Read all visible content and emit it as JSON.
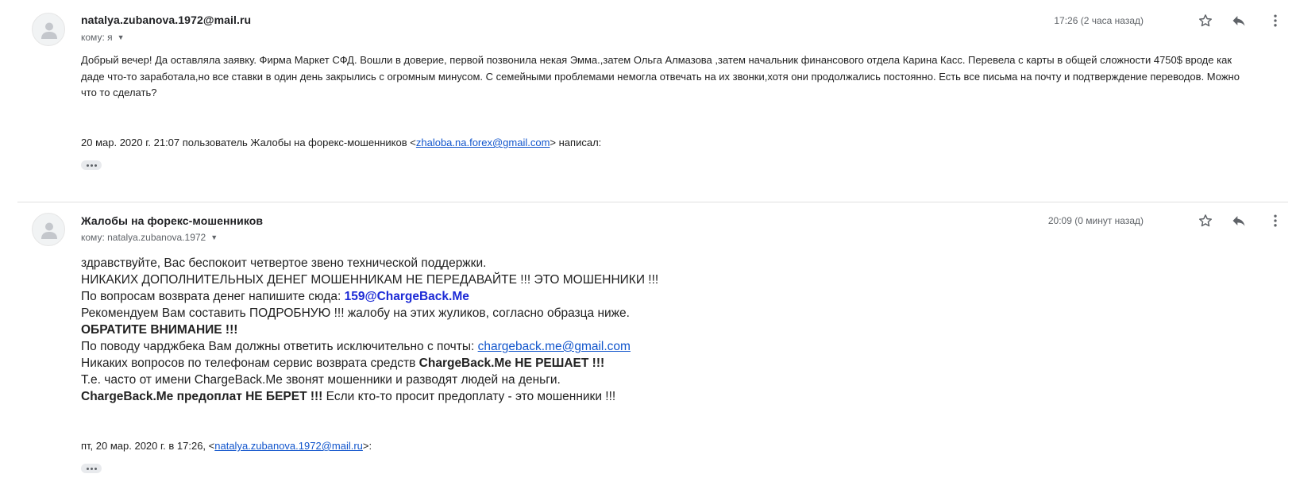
{
  "messages": [
    {
      "sender": "natalya.zubanova.1972@mail.ru",
      "to_label": "кому: я",
      "time": "17:26 (2 часа назад)",
      "body": "Добрый вечер! Да оставляла заявку. Фирма Маркет СФД.  Вошли в доверие, первой позвонила некая Эмма.,затем Ольга Алмазова ,затем начальник финансового отдела  Карина Касс. Перевела с карты в общей сложности 4750$ вроде как даде что-то заработала,но все ставки в один день закрылись с огромным минусом. С семейными проблемами немогла отвечать на их звонки,хотя они продолжались постоянно. Есть все письма на почту и подтверждение переводов. Можно что то сделать?",
      "quote_prefix": "20 мар. 2020 г. 21:07 пользователь Жалобы на форекс-мошенников <",
      "quote_email": "zhaloba.na.forex@gmail.com",
      "quote_suffix": "> написал:"
    },
    {
      "sender": "Жалобы на форекс-мошенников",
      "to_label": "кому: natalya.zubanova.1972",
      "time": "20:09 (0 минут назад)",
      "lines": {
        "l1": "здравствуйте, Вас беспокоит четвертое звено технической поддержки.",
        "l2": "НИКАКИХ ДОПОЛНИТЕЛЬНЫХ ДЕНЕГ МОШЕННИКАМ НЕ ПЕРЕДАВАЙТЕ !!! ЭТО МОШЕННИКИ !!!",
        "l3_text": "По вопросам возврата денег напишите сюда: ",
        "l3_email": "159@ChargeBack.Me",
        "l4": "Рекомендуем Вам составить ПОДРОБНУЮ !!! жалобу на этих жуликов, согласно образца ниже.",
        "l5": "ОБРАТИТЕ ВНИМАНИЕ !!!",
        "l6_text": "По поводу чарджбека Вам должны ответить исключительно с почты: ",
        "l6_link": "chargeback.me@gmail.com",
        "l7_text": "Никаких вопросов по телефонам сервис возврата средств ",
        "l7_bold": "ChargeBack.Me НЕ РЕШАЕТ !!!",
        "l8": "Т.е. часто от имени ChargeBack.Me звонят мошенники и разводят людей на деньги.",
        "l9_bold": "ChargeBack.Me предоплат НЕ БЕРЕТ !!!",
        "l9_text": " Если кто-то просит предоплату - это мошенники !!!"
      },
      "quote_prefix": "пт, 20 мар. 2020 г. в 17:26, <",
      "quote_email": "natalya.zubanova.1972@mail.ru",
      "quote_suffix": ">:"
    }
  ],
  "icons": {
    "avatar": "person-icon",
    "star": "star-icon",
    "reply": "reply-icon",
    "more": "more-vert-icon",
    "expand": "ellipsis-icon"
  },
  "colors": {
    "link": "#1155cc",
    "highlight_email": "#1c2ad6",
    "secondary_text": "#5f6368"
  }
}
